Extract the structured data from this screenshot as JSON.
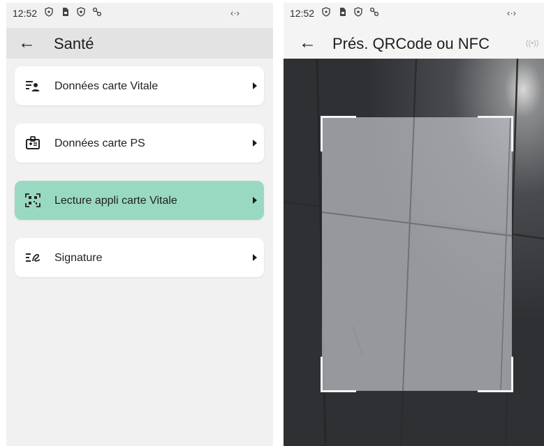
{
  "left_screen": {
    "status": {
      "time": "12:52",
      "network_icon": "link-arrows-icon"
    },
    "appbar": {
      "title": "Santé"
    },
    "menu": [
      {
        "label": "Données carte Vitale",
        "icon": "person-list-icon",
        "active": false
      },
      {
        "label": "Données carte PS",
        "icon": "id-card-icon",
        "active": false
      },
      {
        "label": "Lecture appli carte Vitale",
        "icon": "qr-code-icon",
        "active": true
      },
      {
        "label": "Signature",
        "icon": "signature-icon",
        "active": false
      }
    ]
  },
  "right_screen": {
    "status": {
      "time": "12:52",
      "network_icon": "link-arrows-icon"
    },
    "appbar": {
      "title": "Prés. QRCode ou NFC",
      "nfc_icon": "nfc-icon"
    }
  },
  "colors": {
    "accent": "#99d9c2",
    "card": "#ffffff",
    "background": "#f1f1f1",
    "camera_bg": "#3a3b3e"
  }
}
